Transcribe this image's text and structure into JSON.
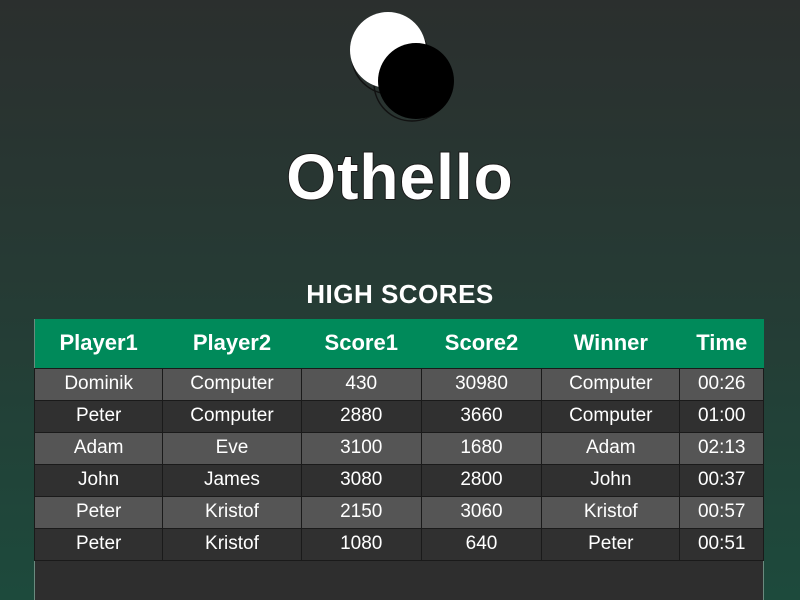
{
  "game": {
    "title": "Othello",
    "logo_icon": "othello-discs-icon"
  },
  "high_scores": {
    "heading": "HIGH SCORES",
    "columns": [
      "Player1",
      "Player2",
      "Score1",
      "Score2",
      "Winner",
      "Time"
    ],
    "rows": [
      [
        "Dominik",
        "Computer",
        "430",
        "30980",
        "Computer",
        "00:26"
      ],
      [
        "Peter",
        "Computer",
        "2880",
        "3660",
        "Computer",
        "01:00"
      ],
      [
        "Adam",
        "Eve",
        "3100",
        "1680",
        "Adam",
        "02:13"
      ],
      [
        "John",
        "James",
        "3080",
        "2800",
        "John",
        "00:37"
      ],
      [
        "Peter",
        "Kristof",
        "2150",
        "3060",
        "Kristof",
        "00:57"
      ],
      [
        "Peter",
        "Kristof",
        "1080",
        "640",
        "Peter",
        "00:51"
      ]
    ]
  },
  "colors": {
    "header_accent": "#008a5a",
    "row_light": "#555555",
    "row_dark": "#303030"
  }
}
